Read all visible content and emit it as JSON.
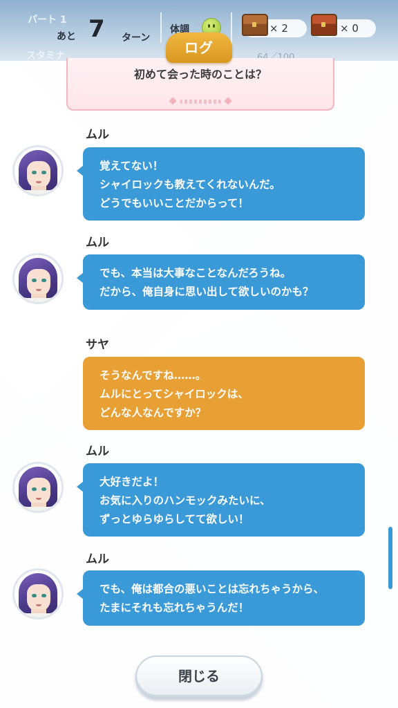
{
  "hud": {
    "part_label": "パート 1",
    "remaining_prefix": "あと",
    "turns_left": "7",
    "turn_unit": "ターン",
    "condition_label": "体調",
    "chest_brown_count": "× 2",
    "chest_red_count": "× 0",
    "stamina_label": "スタミナ",
    "stamina_value": "64／100"
  },
  "log": {
    "title": "ログ",
    "choice_text": "初めて会った時のことは？",
    "messages": [
      {
        "speaker": "ムル",
        "lines": [
          "覚えてない！",
          "シャイロックも教えてくれないんだ。",
          "どうでもいいことだからって！"
        ],
        "style": "blue"
      },
      {
        "speaker": "ムル",
        "lines": [
          "でも、本当は大事なことなんだろうね。",
          "だから、俺自身に思い出して欲しいのかも？"
        ],
        "style": "blue"
      },
      {
        "speaker": "サヤ",
        "lines": [
          "そうなんですね……。",
          "ムルにとってシャイロックは、",
          "どんな人なんですか？"
        ],
        "style": "orange"
      },
      {
        "speaker": "ムル",
        "lines": [
          "大好きだよ！",
          "お気に入りのハンモックみたいに、",
          "ずっとゆらゆらしてて欲しい！"
        ],
        "style": "blue"
      },
      {
        "speaker": "ムル",
        "lines": [
          "でも、俺は都合の悪いことは忘れちゃうから、",
          "たまにそれも忘れちゃうんだ！"
        ],
        "style": "blue"
      }
    ],
    "close_label": "閉じる"
  },
  "colors": {
    "character_bubble": "#3a9ad8",
    "player_bubble": "#e8a035",
    "title_tab": "#e6a52d",
    "choice_border": "#f2b6bf"
  },
  "icons": {
    "condition": "smiley-face-icon",
    "chest": "treasure-chest-icon"
  }
}
